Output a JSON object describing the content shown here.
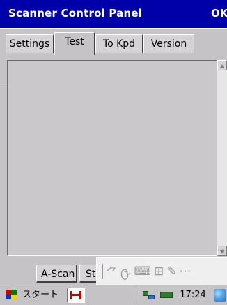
{
  "window": {
    "title": "Scanner Control Panel",
    "ok_label": "OK"
  },
  "tabs": [
    {
      "label": "Settings"
    },
    {
      "label": "Test",
      "active": true
    },
    {
      "label": "To Kpd"
    },
    {
      "label": "Version"
    }
  ],
  "buttons": {
    "ascan_label": "A-Scan",
    "st_label": "St"
  },
  "sip_toolbar": {
    "icons": [
      "hand-icon",
      "kanji-icon",
      "keyboard-icon",
      "conversion-icon",
      "settings-icon",
      "extra-icon"
    ],
    "glyph_hand": "⺈",
    "glyph_kanji": "ᠿ",
    "glyph_kb": "⌨",
    "glyph_kn": "⊞",
    "glyph_misc": "✎",
    "glyph_extra": "⋯"
  },
  "taskbar": {
    "start_label": "スタート",
    "clock": "17:24"
  },
  "colors": {
    "titlebar": "#0000a8",
    "window_bg": "#c6c3c6",
    "tray_accent": "#2b7a2b"
  }
}
